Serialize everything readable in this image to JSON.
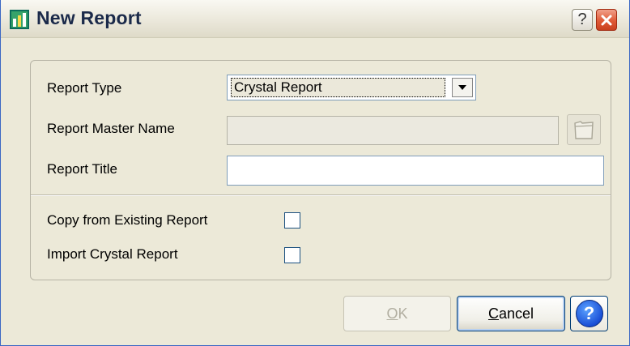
{
  "window": {
    "title": "New Report"
  },
  "titlebar": {
    "help_glyph": "?",
    "close_glyph": "✕"
  },
  "form": {
    "report_type_label": "Report Type",
    "report_type_value": "Crystal Report",
    "report_master_name_label": "Report Master Name",
    "report_master_name_value": "",
    "report_title_label": "Report Title",
    "report_title_value": "",
    "copy_existing_label": "Copy from Existing Report",
    "copy_existing_checked": false,
    "import_crystal_label": "Import Crystal Report",
    "import_crystal_checked": false
  },
  "buttons": {
    "ok_label_mnemonic": "O",
    "ok_label_rest": "K",
    "ok_enabled": false,
    "cancel_label_mnemonic": "C",
    "cancel_label_rest": "ancel",
    "help_glyph": "?"
  },
  "colors": {
    "window_bg": "#ece9d8",
    "close_red": "#e05a36",
    "help_blue": "#1a4fd6"
  }
}
